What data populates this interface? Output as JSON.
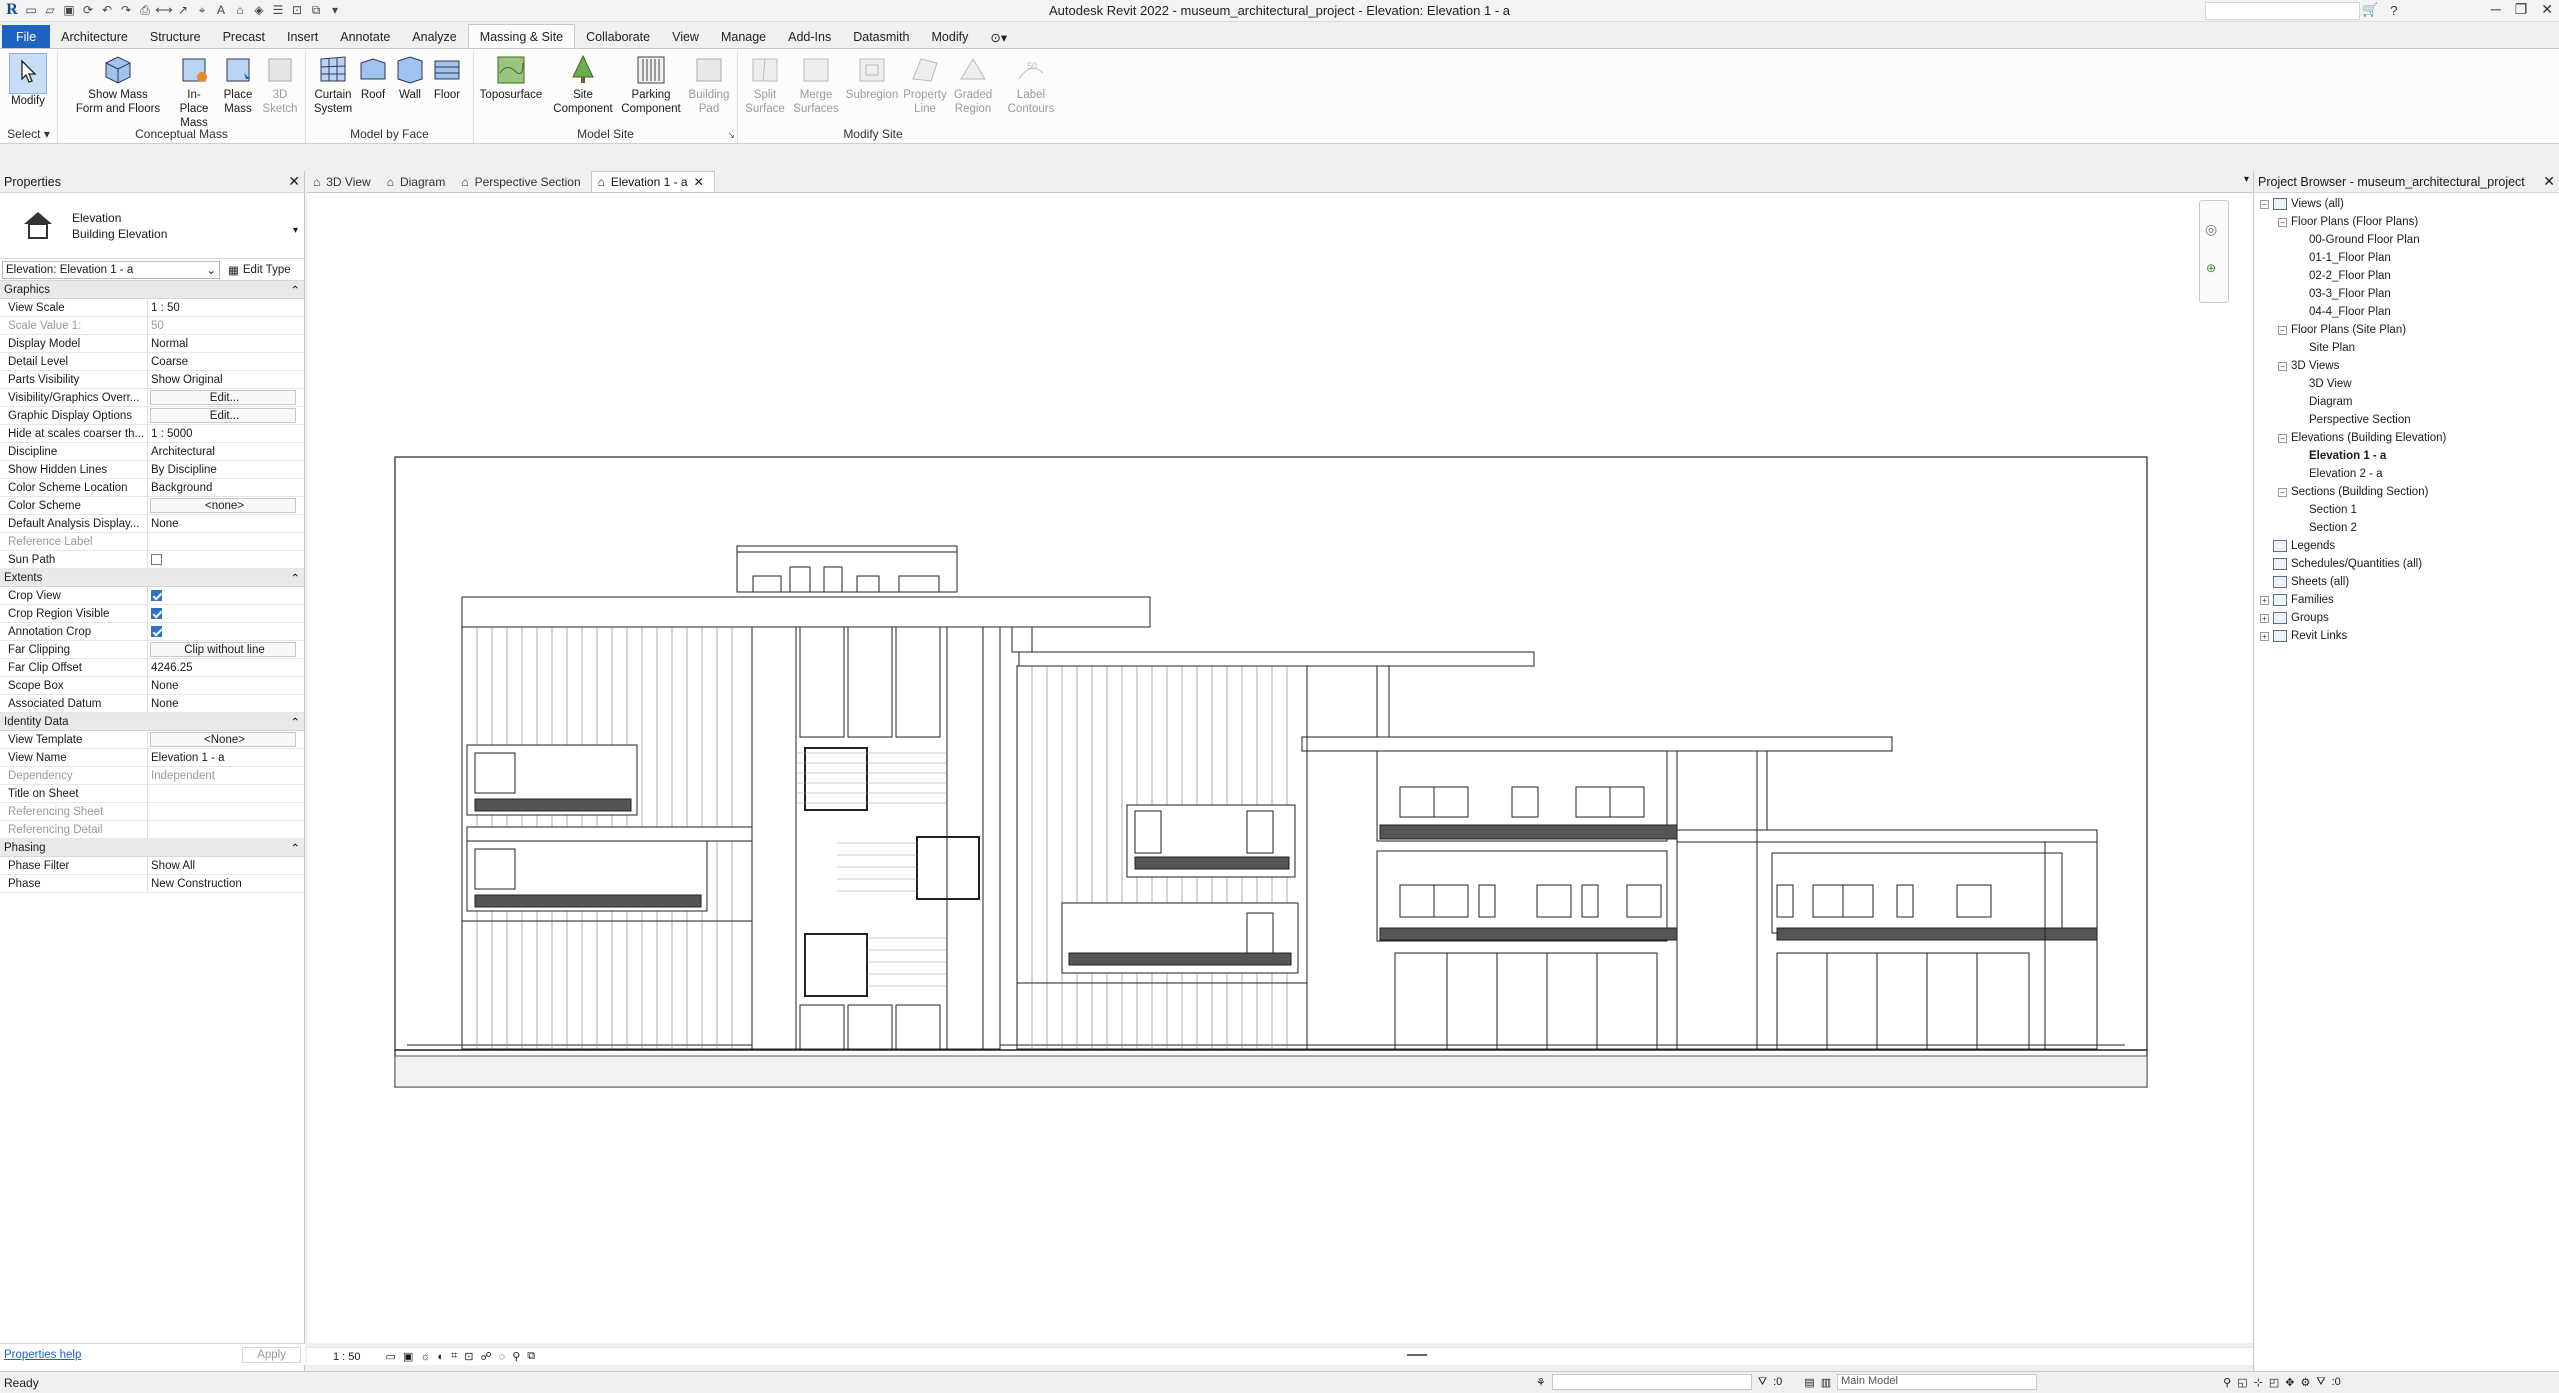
{
  "app": {
    "title": "Autodesk Revit 2022 - museum_architectural_project - Elevation: Elevation 1 - a",
    "logo": "R"
  },
  "ribbon_tabs": [
    "File",
    "Architecture",
    "Structure",
    "Precast",
    "Insert",
    "Annotate",
    "Analyze",
    "Massing & Site",
    "Collaborate",
    "View",
    "Manage",
    "Add-Ins",
    "Datasmith",
    "Modify"
  ],
  "active_tab": "Massing & Site",
  "ribbon": {
    "select": {
      "modify": "Modify",
      "label": "Select ▾"
    },
    "conceptual_mass": {
      "label": "Conceptual Mass",
      "show_mass_1": "Show Mass",
      "show_mass_2": "Form and Floors",
      "inplace_1": "In-Place",
      "inplace_2": "Mass",
      "place_1": "Place",
      "place_2": "Mass",
      "sketch_1": "3D",
      "sketch_2": "Sketch"
    },
    "model_by_face": {
      "label": "Model by Face",
      "curtain_1": "Curtain",
      "curtain_2": "System",
      "roof": "Roof",
      "wall": "Wall",
      "floor": "Floor"
    },
    "model_site": {
      "label": "Model Site",
      "toposurface": "Toposurface",
      "site_1": "Site",
      "site_2": "Component",
      "parking_1": "Parking",
      "parking_2": "Component",
      "building_1": "Building",
      "building_2": "Pad"
    },
    "modify_site": {
      "label": "Modify Site",
      "split_1": "Split",
      "split_2": "Surface",
      "merge_1": "Merge",
      "merge_2": "Surfaces",
      "subregion": "Subregion",
      "property_1": "Property",
      "property_2": "Line",
      "graded_1": "Graded",
      "graded_2": "Region",
      "label_1": "Label",
      "label_2": "Contours"
    }
  },
  "properties": {
    "title": "Properties",
    "type_name": "Elevation",
    "type_sub": "Building Elevation",
    "instance": "Elevation: Elevation 1 - a",
    "edit_type": "Edit Type",
    "help": "Properties help",
    "apply": "Apply",
    "sections": [
      {
        "name": "Graphics",
        "rows": [
          {
            "k": "View Scale",
            "v": "1 : 50"
          },
          {
            "k": "Scale Value    1:",
            "v": "50",
            "dim": true
          },
          {
            "k": "Display Model",
            "v": "Normal"
          },
          {
            "k": "Detail Level",
            "v": "Coarse"
          },
          {
            "k": "Parts Visibility",
            "v": "Show Original"
          },
          {
            "k": "Visibility/Graphics Overr...",
            "v": "Edit...",
            "btn": true
          },
          {
            "k": "Graphic Display Options",
            "v": "Edit...",
            "btn": true
          },
          {
            "k": "Hide at scales coarser th...",
            "v": "1 : 5000"
          },
          {
            "k": "Discipline",
            "v": "Architectural"
          },
          {
            "k": "Show Hidden Lines",
            "v": "By Discipline"
          },
          {
            "k": "Color Scheme Location",
            "v": "Background"
          },
          {
            "k": "Color Scheme",
            "v": "<none>",
            "btn": true
          },
          {
            "k": "Default Analysis Display...",
            "v": "None"
          },
          {
            "k": "Reference Label",
            "v": "",
            "dim": true
          },
          {
            "k": "Sun Path",
            "v": "",
            "check": false
          }
        ]
      },
      {
        "name": "Extents",
        "rows": [
          {
            "k": "Crop View",
            "v": "",
            "check": true
          },
          {
            "k": "Crop Region Visible",
            "v": "",
            "check": true
          },
          {
            "k": "Annotation Crop",
            "v": "",
            "check": true
          },
          {
            "k": "Far Clipping",
            "v": "Clip without line",
            "btn": true
          },
          {
            "k": "Far Clip Offset",
            "v": "4246.25"
          },
          {
            "k": "Scope Box",
            "v": "None"
          },
          {
            "k": "Associated Datum",
            "v": "None"
          }
        ]
      },
      {
        "name": "Identity Data",
        "rows": [
          {
            "k": "View Template",
            "v": "<None>",
            "btn": true
          },
          {
            "k": "View Name",
            "v": "Elevation 1 - a"
          },
          {
            "k": "Dependency",
            "v": "Independent",
            "dim": true
          },
          {
            "k": "Title on Sheet",
            "v": ""
          },
          {
            "k": "Referencing Sheet",
            "v": "",
            "dim": true
          },
          {
            "k": "Referencing Detail",
            "v": "",
            "dim": true
          }
        ]
      },
      {
        "name": "Phasing",
        "rows": [
          {
            "k": "Phase Filter",
            "v": "Show All"
          },
          {
            "k": "Phase",
            "v": "New Construction"
          }
        ]
      }
    ]
  },
  "view_tabs": [
    "3D View",
    "Diagram",
    "Perspective Section",
    "Elevation 1 - a"
  ],
  "active_view_tab": "Elevation 1 - a",
  "view_scale": "1 : 50",
  "browser": {
    "title": "Project Browser - museum_architectural_project",
    "nodes": [
      {
        "label": "Views (all)",
        "level": 0,
        "exp": "-",
        "icon": true
      },
      {
        "label": "Floor Plans (Floor Plans)",
        "level": 1,
        "exp": "-"
      },
      {
        "label": "00-Ground Floor Plan",
        "level": 2
      },
      {
        "label": "01-1_Floor Plan",
        "level": 2
      },
      {
        "label": "02-2_Floor Plan",
        "level": 2
      },
      {
        "label": "03-3_Floor Plan",
        "level": 2
      },
      {
        "label": "04-4_Floor Plan",
        "level": 2
      },
      {
        "label": "Floor Plans (Site Plan)",
        "level": 1,
        "exp": "-"
      },
      {
        "label": "Site Plan",
        "level": 2
      },
      {
        "label": "3D Views",
        "level": 1,
        "exp": "-"
      },
      {
        "label": "3D View",
        "level": 2
      },
      {
        "label": "Diagram",
        "level": 2
      },
      {
        "label": "Perspective Section",
        "level": 2
      },
      {
        "label": "Elevations (Building Elevation)",
        "level": 1,
        "exp": "-"
      },
      {
        "label": "Elevation 1 - a",
        "level": 2,
        "bold": true
      },
      {
        "label": "Elevation 2 - a",
        "level": 2
      },
      {
        "label": "Sections (Building Section)",
        "level": 1,
        "exp": "-"
      },
      {
        "label": "Section 1",
        "level": 2
      },
      {
        "label": "Section 2",
        "level": 2
      },
      {
        "label": "Legends",
        "level": 0,
        "icon": true
      },
      {
        "label": "Schedules/Quantities (all)",
        "level": 0,
        "icon": true
      },
      {
        "label": "Sheets (all)",
        "level": 0,
        "icon": true
      },
      {
        "label": "Families",
        "level": 0,
        "exp": "+",
        "icon": true
      },
      {
        "label": "Groups",
        "level": 0,
        "exp": "+",
        "icon": true
      },
      {
        "label": "Revit Links",
        "level": 0,
        "exp": "+",
        "icon": true
      }
    ]
  },
  "status": {
    "text": "Ready",
    "count": ":0",
    "model": "Main Model"
  }
}
